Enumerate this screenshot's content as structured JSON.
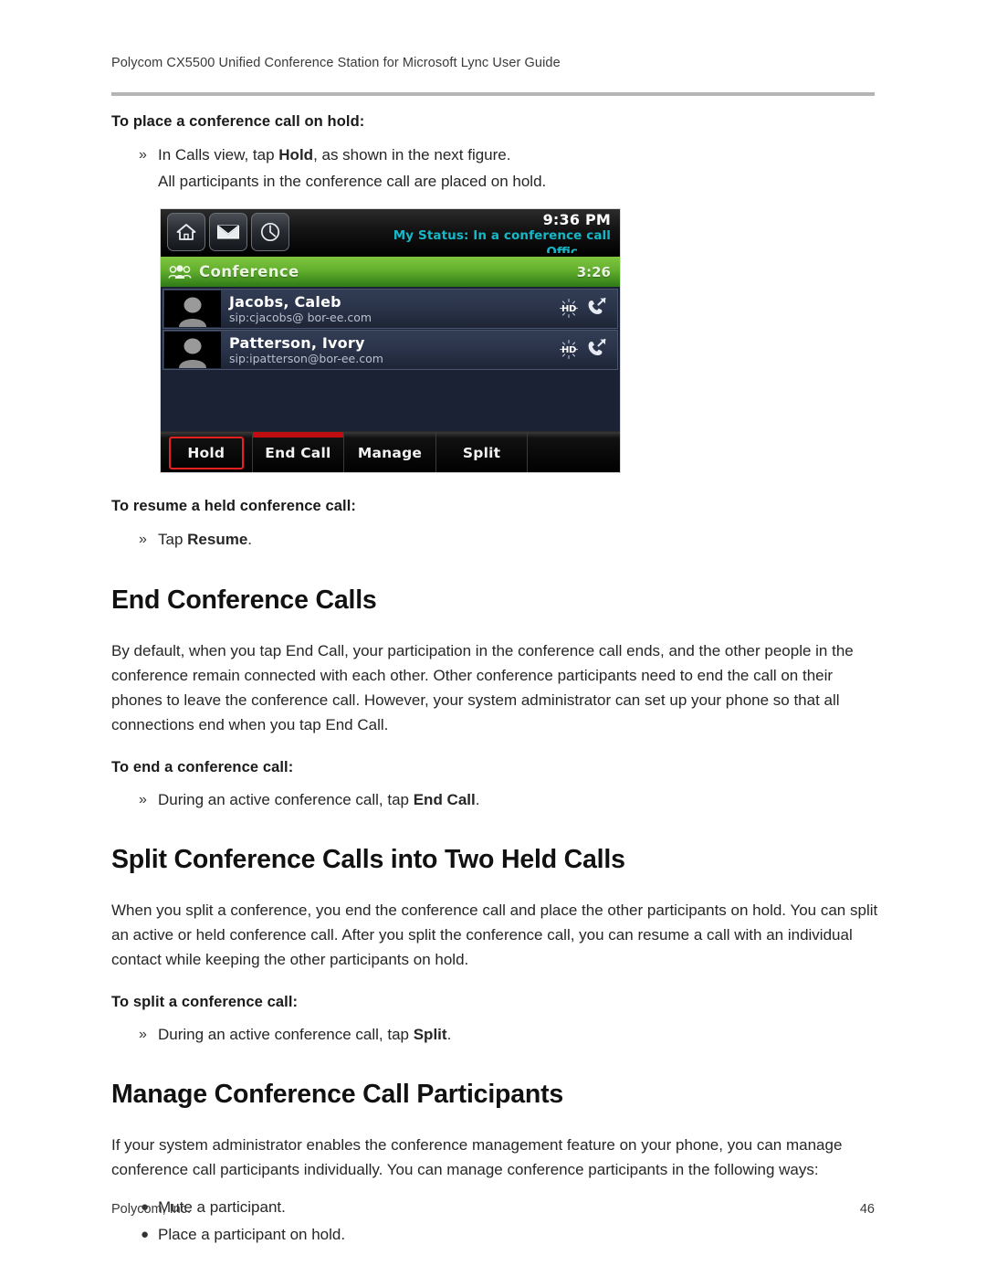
{
  "document": {
    "running_header": "Polycom CX5500 Unified Conference Station for Microsoft Lync User Guide",
    "footer_left": "Polycom, Inc.",
    "footer_page_number": "46"
  },
  "colors": {
    "rule": "#b4b4b4",
    "callout_red": "#e8201f",
    "softkey_indicator_red": "#c00d12",
    "conference_green": "#63b02e",
    "status_cyan": "#16b8c8",
    "row_blue": "#2a3349"
  },
  "procedures": {
    "place_on_hold": {
      "title": "To place a conference call on hold:",
      "step_prefix": "In Calls view, tap ",
      "step_bold": "Hold",
      "step_suffix": ", as shown in the next figure.",
      "note": "All participants in the conference call are placed on hold."
    },
    "resume_held": {
      "title": "To resume a held conference call:",
      "step_prefix": "Tap ",
      "step_bold": "Resume",
      "step_suffix": "."
    },
    "end_call": {
      "title": "To end a conference call:",
      "step_prefix": "During an active conference call, tap ",
      "step_bold": "End Call",
      "step_suffix": "."
    },
    "split_call": {
      "title": "To split a conference call:",
      "step_prefix": "During an active conference call, tap ",
      "step_bold": "Split",
      "step_suffix": "."
    }
  },
  "sections": [
    {
      "heading": "End Conference Calls",
      "body": "By default, when you tap End Call, your participation in the conference call ends, and the other people in the conference remain connected with each other. Other conference participants need to end the call on their phones to leave the conference call. However, your system administrator can set up your phone so that all connections end when you tap End Call."
    },
    {
      "heading": "Split Conference Calls into Two Held Calls",
      "body": "When you split a conference, you end the conference call and place the other participants on hold. You can split an active or held conference call. After you split the conference call, you can resume a call with an individual contact while keeping the other participants on hold."
    },
    {
      "heading": "Manage Conference Call Participants",
      "body": "If your system administrator enables the conference management feature on your phone, you can manage conference call participants individually. You can manage conference participants in the following ways:",
      "bullets": [
        "Mute a participant.",
        "Place a participant on hold."
      ]
    }
  ],
  "figure": {
    "status_bar": {
      "time": "9:36 PM",
      "my_status": "My Status: In a conference call",
      "my_status_clipped": "Offic ...",
      "icons": [
        "home-icon",
        "message-icon",
        "recent-calls-icon"
      ]
    },
    "conference_bar": {
      "icon": "conference-group-icon",
      "label": "Conference",
      "timer": "3:26"
    },
    "participants": [
      {
        "name": "Jacobs, Caleb",
        "sip": "sip:cjacobs@ bor-ee.com",
        "hd_badge": "HD",
        "call_icon": "outgoing-call-icon"
      },
      {
        "name": "Patterson, Ivory",
        "sip": "sip:ipatterson@bor-ee.com",
        "hd_badge": "HD",
        "call_icon": "outgoing-call-icon"
      }
    ],
    "soft_keys": [
      {
        "label": "Hold",
        "highlighted": true,
        "indicator": false
      },
      {
        "label": "End Call",
        "highlighted": false,
        "indicator": true
      },
      {
        "label": "Manage",
        "highlighted": false,
        "indicator": false
      },
      {
        "label": "Split",
        "highlighted": false,
        "indicator": false
      },
      {
        "label": "",
        "highlighted": false,
        "indicator": false
      }
    ]
  }
}
